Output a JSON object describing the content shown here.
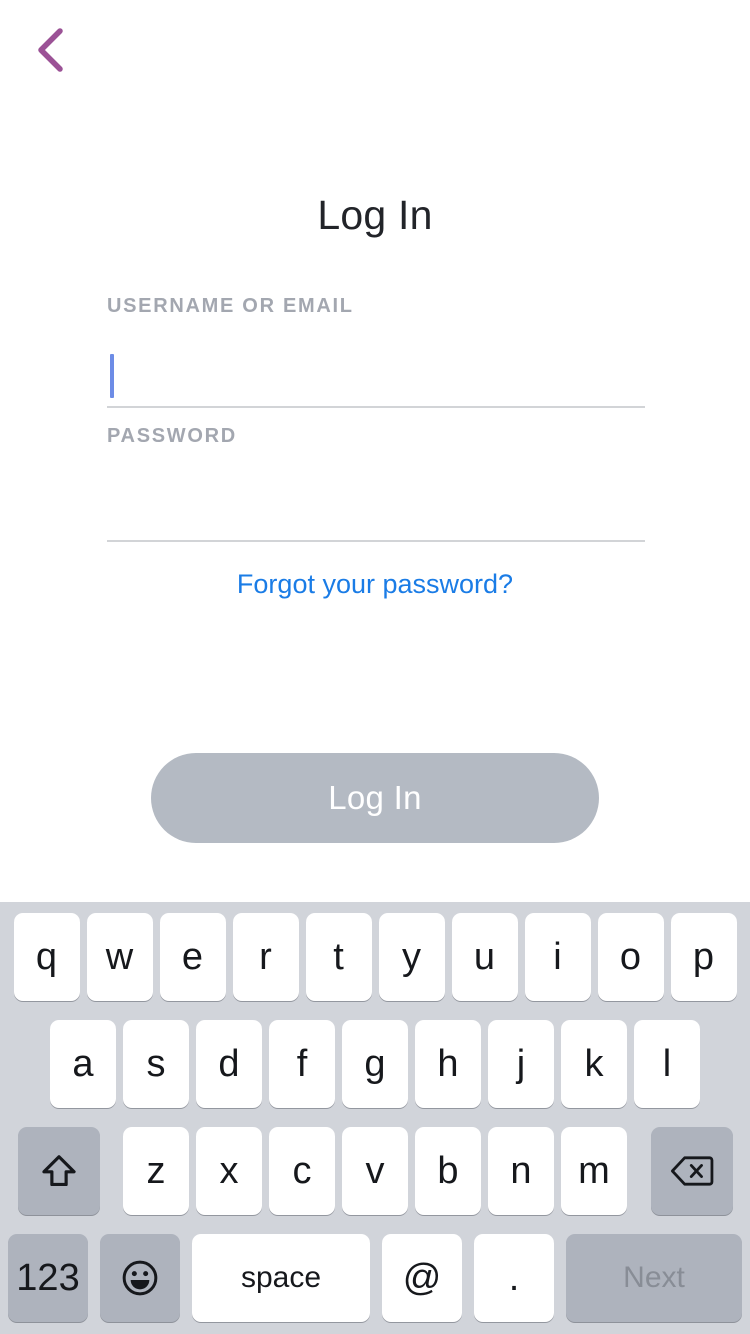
{
  "screen": {
    "name": "login-screen",
    "background": "#ffffff"
  },
  "nav": {
    "back_icon": "chevron-left-icon",
    "back_color": "#9b5296"
  },
  "header": {
    "title": "Log In"
  },
  "form": {
    "username": {
      "label": "USERNAME OR EMAIL",
      "value": "",
      "placeholder": "",
      "focused": true,
      "caret_color": "#6d8ce6"
    },
    "password": {
      "label": "PASSWORD",
      "value": "",
      "placeholder": "",
      "focused": false
    },
    "forgot_link": "Forgot your password?",
    "forgot_link_color": "#1a7ce6"
  },
  "actions": {
    "login_label": "Log In",
    "login_enabled": false,
    "login_bg": "#b4bac3",
    "login_text_color": "#ffffff"
  },
  "keyboard": {
    "background": "#d1d4da",
    "key_bg": "#ffffff",
    "modifier_key_bg": "#aeb3bd",
    "row1": [
      "q",
      "w",
      "e",
      "r",
      "t",
      "y",
      "u",
      "i",
      "o",
      "p"
    ],
    "row2": [
      "a",
      "s",
      "d",
      "f",
      "g",
      "h",
      "j",
      "k",
      "l"
    ],
    "row3": {
      "shift_icon": "shift-arrow-icon",
      "letters": [
        "z",
        "x",
        "c",
        "v",
        "b",
        "n",
        "m"
      ],
      "backspace_icon": "backspace-icon"
    },
    "row4": {
      "numbers_label": "123",
      "emoji_icon": "emoji-smiley-icon",
      "space_label": "space",
      "at_label": "@",
      "period_label": ".",
      "return_label": "Next",
      "return_enabled": false
    }
  }
}
